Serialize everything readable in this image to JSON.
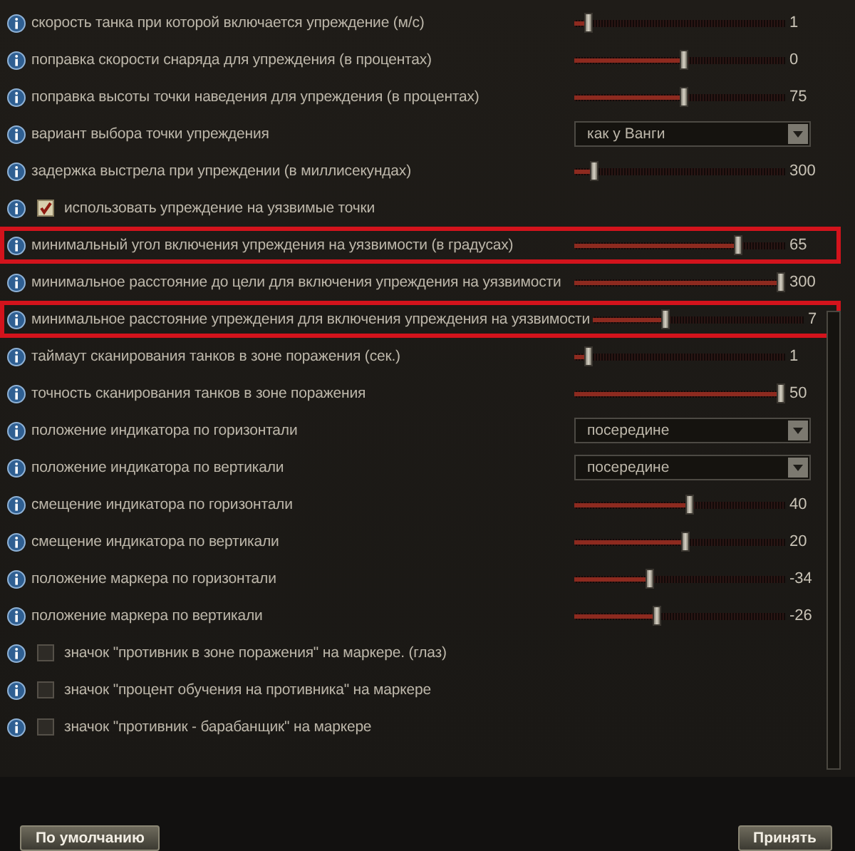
{
  "settings": [
    {
      "kind": "slider",
      "label": "скорость танка при которой включается упреждение (м/с)",
      "level": 0.05,
      "value": "1",
      "highlighted": false
    },
    {
      "kind": "slider",
      "label": "поправка скорости снаряда для упреждения (в процентах)",
      "level": 0.52,
      "value": "0",
      "highlighted": false
    },
    {
      "kind": "slider",
      "label": "поправка высоты точки наведения для упреждения (в процентах)",
      "level": 0.52,
      "value": "75",
      "highlighted": false
    },
    {
      "kind": "select",
      "label": "вариант выбора точки упреждения",
      "value": "как у Ванги",
      "highlighted": false
    },
    {
      "kind": "slider",
      "label": "задержка выстрела при упреждении (в миллисекундах)",
      "level": 0.08,
      "value": "300",
      "highlighted": false
    },
    {
      "kind": "checkbox",
      "label": "использовать упреждение на уязвимые точки",
      "checked": true,
      "highlighted": false
    },
    {
      "kind": "slider",
      "label": "минимальный угол включения упреждения на уязвимости (в градусах)",
      "level": 0.79,
      "value": "65",
      "highlighted": true
    },
    {
      "kind": "slider",
      "label": "минимальное расстояние до цели для включения упреждения на уязвимости",
      "level": 1,
      "value": "300",
      "highlighted": false
    },
    {
      "kind": "slider",
      "label": "минимальное расстояние упреждения для включения упреждения на уязвимости",
      "level": 0.34,
      "value": "7",
      "highlighted": true
    },
    {
      "kind": "slider",
      "label": "таймаут сканирования танков в зоне поражения (сек.)",
      "level": 0.05,
      "value": "1",
      "highlighted": false
    },
    {
      "kind": "slider",
      "label": "точность сканирования танков в зоне поражения",
      "level": 1,
      "value": "50",
      "highlighted": false
    },
    {
      "kind": "select",
      "label": "положение индикатора по горизонтали",
      "value": "посередине",
      "highlighted": false
    },
    {
      "kind": "select",
      "label": "положение индикатора по вертикали",
      "value": "посередине",
      "highlighted": false
    },
    {
      "kind": "slider",
      "label": "смещение индикатора по горизонтали",
      "level": 0.55,
      "value": "40",
      "highlighted": false
    },
    {
      "kind": "slider",
      "label": "смещение индикатора по вертикали",
      "level": 0.53,
      "value": "20",
      "highlighted": false
    },
    {
      "kind": "slider",
      "label": "положение маркера по горизонтали",
      "level": 0.35,
      "value": "-34",
      "highlighted": false
    },
    {
      "kind": "slider",
      "label": "положение маркера по вертикали",
      "level": 0.39,
      "value": "-26",
      "highlighted": false
    },
    {
      "kind": "checkbox",
      "label": "значок \"противник в зоне поражения\" на маркере. (глаз)",
      "checked": false,
      "highlighted": false
    },
    {
      "kind": "checkbox",
      "label": "значок \"процент обучения на противника\" на маркере",
      "checked": false,
      "highlighted": false
    },
    {
      "kind": "checkbox",
      "label": "значок \"противник - барабанщик\" на маркере",
      "checked": false,
      "highlighted": false
    }
  ],
  "buttons": [
    {
      "label": "По умолчанию"
    },
    {
      "label": "Принять"
    }
  ]
}
